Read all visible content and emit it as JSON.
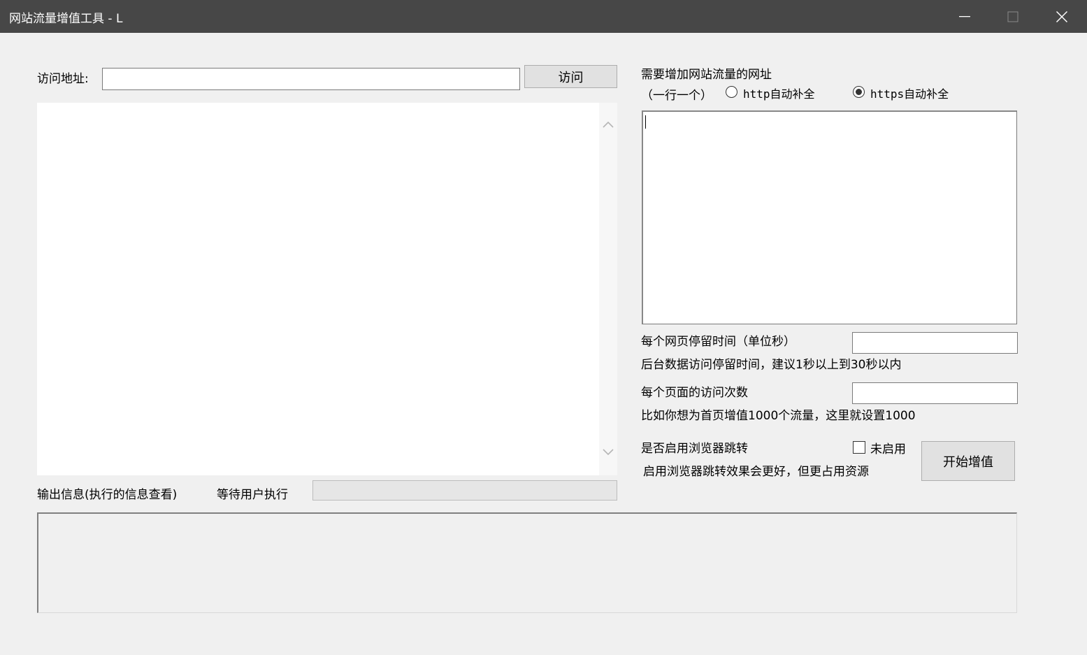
{
  "window": {
    "title": "网站流量增值工具 - L"
  },
  "browser": {
    "address_label": "访问地址:",
    "address_value": "",
    "visit_button": "访问"
  },
  "urls_panel": {
    "heading": "需要增加网站流量的网址",
    "per_line_note": "（一行一个）",
    "http_option": "http自动补全",
    "https_option": "https自动补全",
    "selected": "https",
    "urls_value": ""
  },
  "stay_time": {
    "label": "每个网页停留时间（单位秒）",
    "value": "",
    "hint": "后台数据访问停留时间，建议1秒以上到30秒以内"
  },
  "visit_count": {
    "label": "每个页面的访问次数",
    "value": "",
    "hint": "比如你想为首页增值1000个流量，这里就设置1000"
  },
  "redirect": {
    "label": "是否启用浏览器跳转",
    "checkbox_label": "未启用",
    "checked": false,
    "hint": "启用浏览器跳转效果会更好，但更占用资源"
  },
  "start_button": "开始增值",
  "output": {
    "label": "输出信息(执行的信息查看)",
    "status": "等待用户执行",
    "progress": 0,
    "log": ""
  }
}
